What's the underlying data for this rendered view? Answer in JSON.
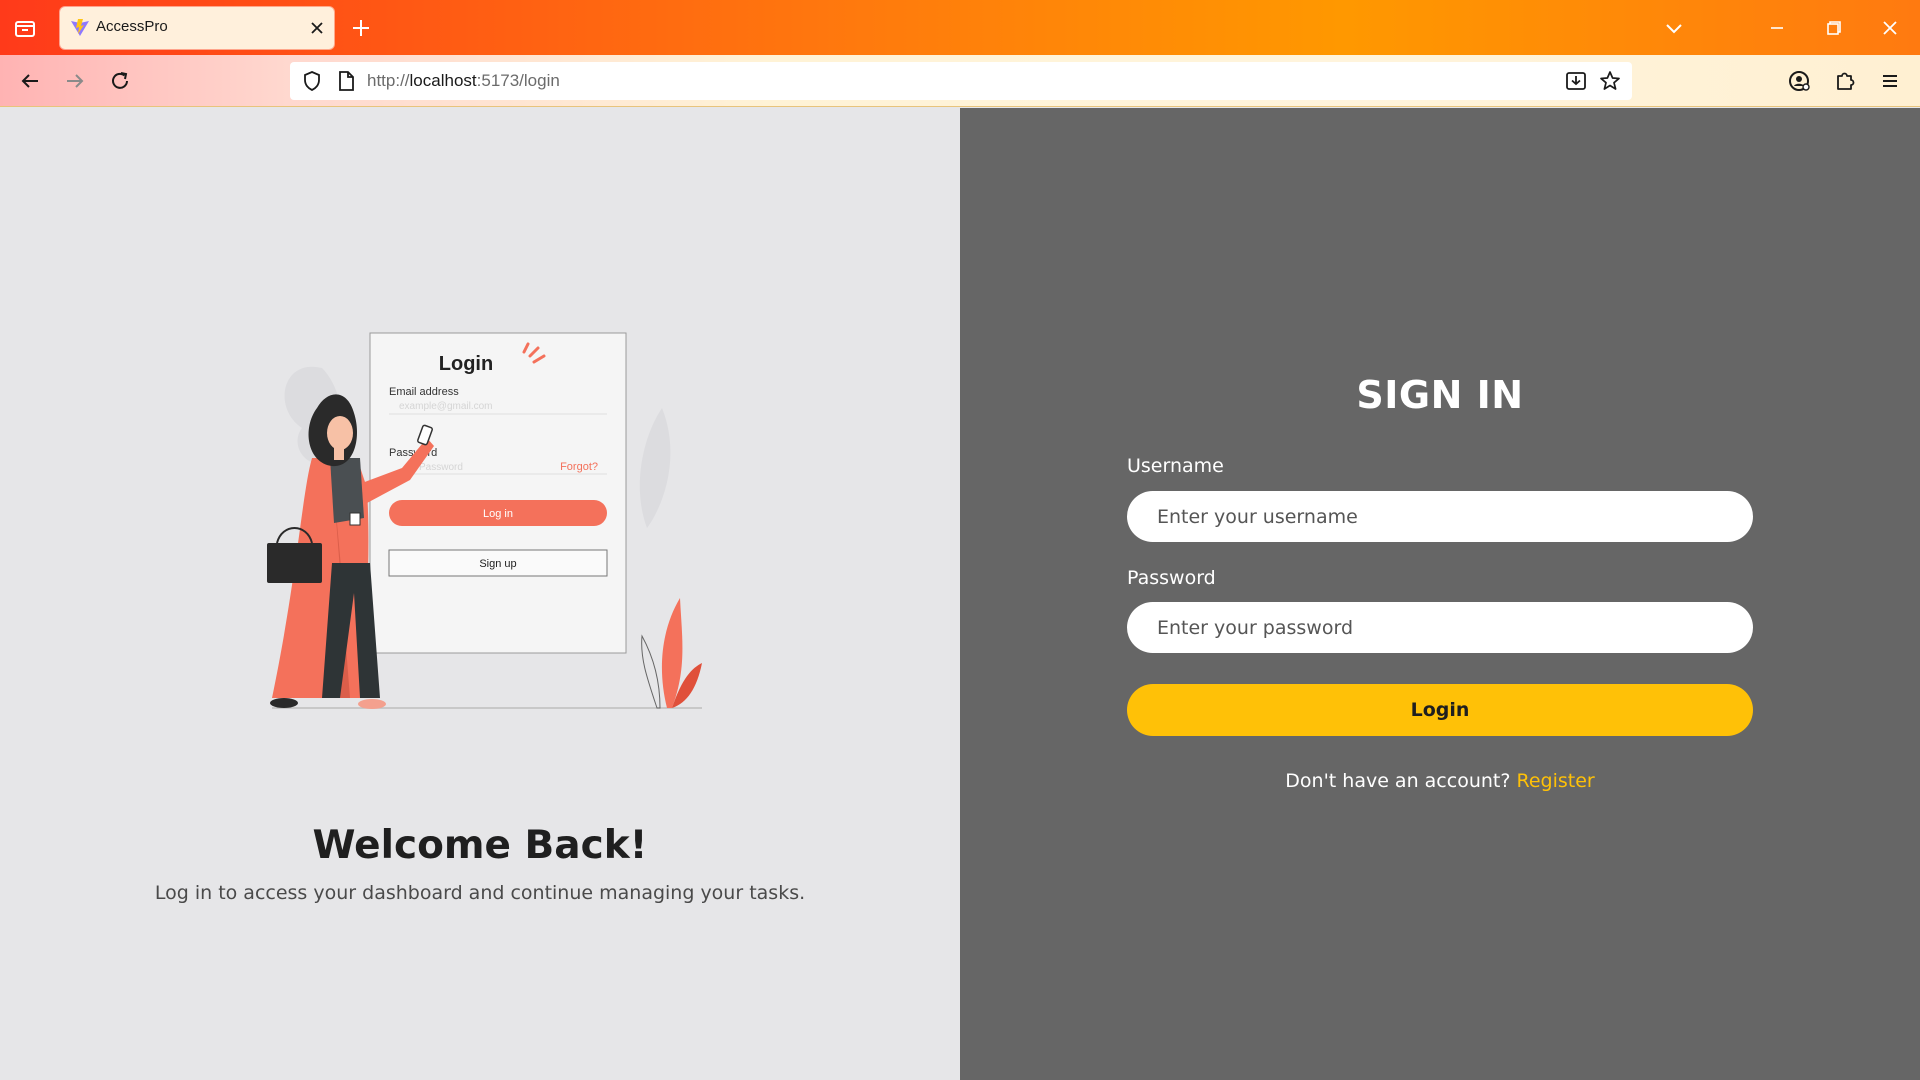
{
  "browser": {
    "tab": {
      "title": "AccessPro"
    },
    "url": {
      "scheme": "http://",
      "host": "localhost",
      "rest": ":5173/login"
    }
  },
  "illustration": {
    "card_title": "Login",
    "email_label": "Email address",
    "email_placeholder": "example@gmail.com",
    "password_label": "Password",
    "password_placeholder": "Password",
    "forgot_label": "Forgot?",
    "login_button": "Log in",
    "signup_button": "Sign up"
  },
  "welcome": {
    "title": "Welcome Back!",
    "subtitle": "Log in to access your dashboard and continue managing your tasks."
  },
  "signin": {
    "title": "SIGN IN",
    "username_label": "Username",
    "username_placeholder": "Enter your username",
    "password_label": "Password",
    "password_placeholder": "Enter your password",
    "login_button": "Login",
    "register_prompt": "Don't have an account?",
    "register_link": "Register"
  },
  "colors": {
    "left_bg": "#e6e6e8",
    "right_bg": "#666666",
    "accent": "#ffc107",
    "illustration_coral": "#f4715b"
  }
}
